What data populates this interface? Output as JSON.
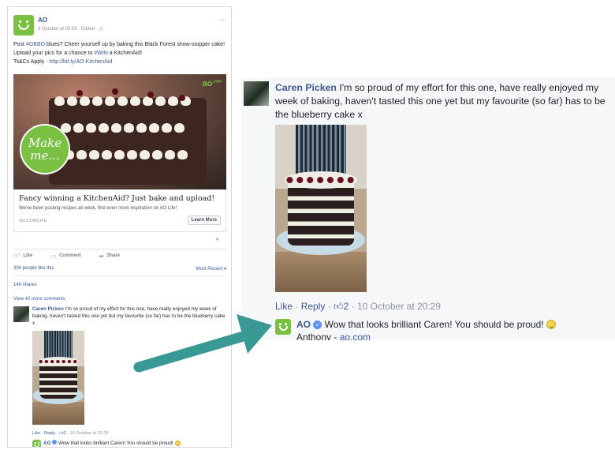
{
  "post": {
    "page_name": "AO",
    "meta": "8 October at 09:55 · Edited · ◷",
    "body_line1_a": "Post ",
    "hashtag1": "#GBBO",
    "body_line1_b": " blues? Cheer yourself up by baking this Black Forest show-stopper cake! Upload your pics for a chance to ",
    "hashtag2": "#WIN",
    "body_line1_c": " a KitchenAid!",
    "tcs_label": "Ts&Cs Apply - ",
    "tcs_link": "http://bit.ly/AO-KitchenAid",
    "image_badge": "Make me...",
    "image_logo": "ao",
    "image_logo_suffix": ".com",
    "card_title": "Fancy winning a KitchenAid? Just bake and upload!",
    "card_desc": "We've been posting recipes all week, find even more inspiration on AO Life!",
    "card_domain": "AO.COM/LIFE",
    "learn_more": "Learn More",
    "action_like": "Like",
    "action_comment": "Comment",
    "action_share": "Share",
    "likes_count": "304 people like this.",
    "most_recent": "Most Recent",
    "shares": "146 shares",
    "view_more": "View 42 more comments"
  },
  "comment": {
    "author": "Caren Picken",
    "text": " I'm so proud of my effort for this one, have really enjoyed my week of baking, haven't tasted this one yet but my favourite (so far) has to be the blueberry cake x",
    "like": "Like",
    "reply": "Reply",
    "reactions": "2",
    "timestamp": "10 October at 20:29"
  },
  "reply": {
    "author": "AO",
    "text": " Wow that looks brilliant Caren! You should be proud!",
    "signoff": "Anthony - ",
    "signoff_link": "ao.com"
  },
  "colors": {
    "brand_green": "#7ac143",
    "facebook_blue": "#3b5998",
    "arrow_teal": "#3a9994"
  }
}
